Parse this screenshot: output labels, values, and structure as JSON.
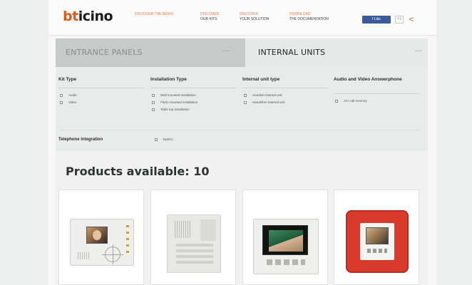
{
  "header": {
    "logo": {
      "accent": "bt",
      "rest": "icino"
    },
    "nav": [
      {
        "line1": "Discover the news",
        "line2": ""
      },
      {
        "line1": "Discover",
        "line2": "our kits"
      },
      {
        "line1": "Discover",
        "line2": "your solution"
      },
      {
        "line1": "Download",
        "line2": "the documentation"
      }
    ],
    "facebook_label": "f Like",
    "google_label": "+1",
    "share_icon": "share-icon"
  },
  "tabs": [
    {
      "label": "ENTRANCE PANELS",
      "toggle": "—",
      "active": false
    },
    {
      "label": "INTERNAL UNITS",
      "toggle": "—",
      "active": true
    }
  ],
  "filters": [
    {
      "title": "Kit Type",
      "options": [
        "Audio",
        "Video"
      ]
    },
    {
      "title": "Installation Type",
      "options": [
        "Wall mounted installation",
        "Flush mounted installation",
        "Table top installation"
      ]
    },
    {
      "title": "Internal unit type",
      "options": [
        "Handset internal unit",
        "Handsfree internal unit"
      ]
    },
    {
      "title": "Audio and Video Answerphone",
      "options": [
        "A/V call memory"
      ]
    }
  ],
  "telephone": {
    "title": "Telephone integration",
    "option": "Built-in"
  },
  "products": {
    "heading": "Products available: 10",
    "items": [
      {
        "name": "white-video-handset"
      },
      {
        "name": "grey-audio-handset"
      },
      {
        "name": "video-handset-dark-screen"
      },
      {
        "name": "red-framed-video-unit"
      }
    ]
  },
  "colors": {
    "brand_orange": "#e05a1c",
    "active_tab_bg": "#e7e9e8",
    "inactive_tab_bg": "#c8cac9",
    "facebook_blue": "#3b5a9a",
    "product4_red": "#d83a2c"
  }
}
